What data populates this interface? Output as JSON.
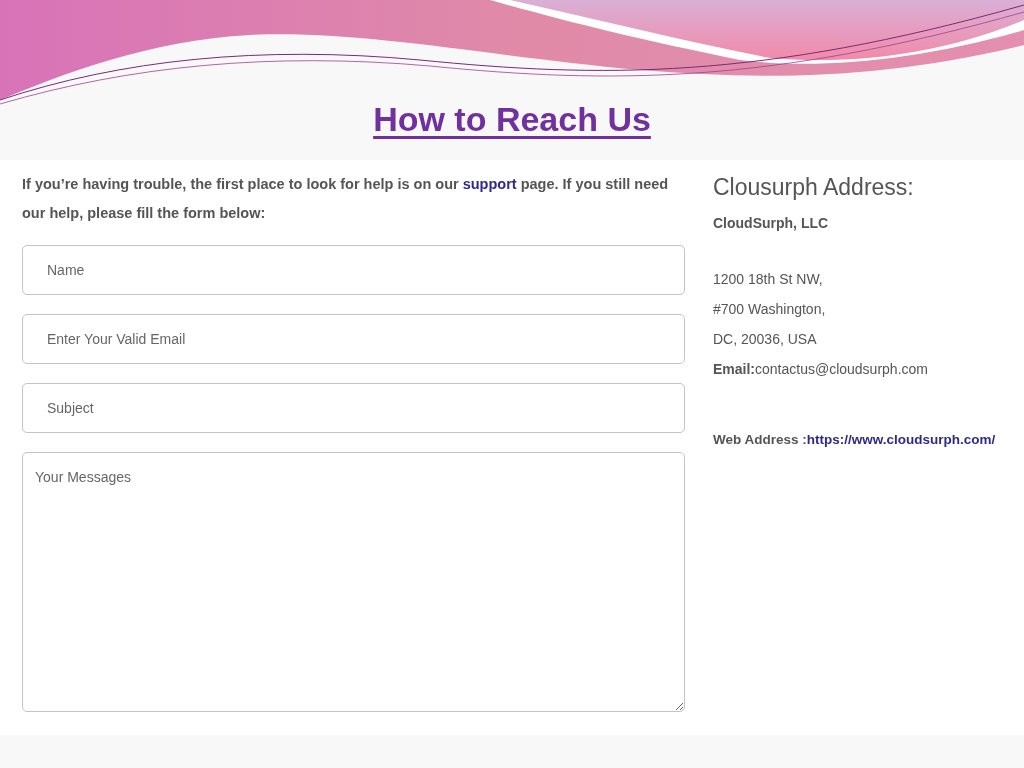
{
  "slide": {
    "title": "How to Reach Us"
  },
  "intro": {
    "before": "If you’re having trouble, the first place to look for help is on our",
    "link": "support",
    "after": "page. If you still need our help, please fill the form below:"
  },
  "form": {
    "fields": [
      {
        "kind": "input",
        "placeholder": "Name"
      },
      {
        "kind": "input",
        "placeholder": "Enter Your Valid Email"
      },
      {
        "kind": "input",
        "placeholder": "Subject"
      },
      {
        "kind": "textarea",
        "placeholder": "Your Messages"
      }
    ]
  },
  "address": {
    "heading": "Clousurph Address:",
    "company": "CloudSurph, LLC",
    "lines": [
      "1200 18th St NW,",
      "#700 Washington,",
      "DC, 20036, USA"
    ],
    "email_label": "Email:",
    "email": "contactus@cloudsurph.com",
    "web_label": "Web Address :",
    "web_link": "https://www.cloudsurph.com/"
  }
}
